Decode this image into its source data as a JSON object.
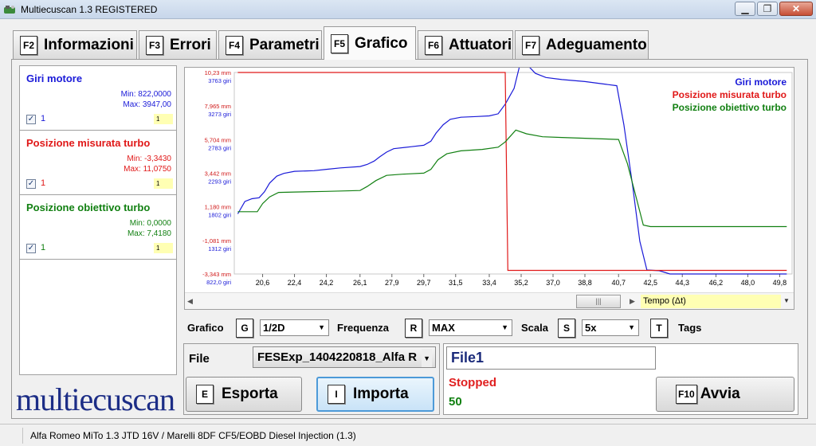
{
  "window": {
    "title": "Multiecuscan 1.3 REGISTERED",
    "minimize": "▁",
    "restore": "❐",
    "close": "✕"
  },
  "tabs": [
    {
      "key": "F2",
      "label": "Informazioni"
    },
    {
      "key": "F3",
      "label": "Errori"
    },
    {
      "key": "F4",
      "label": "Parametri"
    },
    {
      "key": "F5",
      "label": "Grafico",
      "active": true
    },
    {
      "key": "F6",
      "label": "Attuatori"
    },
    {
      "key": "F7",
      "label": "Adeguamento"
    }
  ],
  "series_panel": [
    {
      "name": "Giri motore",
      "min": "Min: 822,0000",
      "max": "Max: 3947,00",
      "checked": "✓",
      "index": "1",
      "box": "1",
      "color": "#1a1ad8"
    },
    {
      "name": "Posizione misurata turbo",
      "min": "Min: -3,3430",
      "max": "Max: 11,0750",
      "checked": "✓",
      "index": "1",
      "box": "1",
      "color": "#e01818"
    },
    {
      "name": "Posizione obiettivo turbo",
      "min": "Min: 0,0000",
      "max": "Max: 7,4180",
      "checked": "✓",
      "index": "1",
      "box": "1",
      "color": "#128012"
    }
  ],
  "chart_data": {
    "type": "line",
    "xlabel": "Tempo (Δt)",
    "x_ticks": [
      "20,6",
      "22,4",
      "24,2",
      "26,1",
      "27,9",
      "29,7",
      "31,5",
      "33,4",
      "35,2",
      "37,0",
      "38,8",
      "40,7",
      "42,5",
      "44,3",
      "46,2",
      "48,0",
      "49,8"
    ],
    "x_range": [
      19.0,
      50.5
    ],
    "y_ticks_mm": [
      "10,23 mm",
      "7,965 mm",
      "5,704 mm",
      "3,442 mm",
      "1,180 mm",
      "-1,081 mm",
      "-3,343 mm"
    ],
    "y_ticks_giri": [
      "3763 giri",
      "3273 giri",
      "2783 giri",
      "2293 giri",
      "1802 giri",
      "1312 giri",
      "822,0 giri"
    ],
    "legend": [
      {
        "name": "Giri motore",
        "color": "#1a1ad8"
      },
      {
        "name": "Posizione misurata turbo",
        "color": "#e01818"
      },
      {
        "name": "Posizione obiettivo turbo",
        "color": "#128012"
      }
    ],
    "series": [
      {
        "name": "Giri motore",
        "unit": "giri",
        "color": "#1a1ad8",
        "y_range": [
          822,
          3763
        ],
        "points": [
          [
            19.2,
            1700
          ],
          [
            19.6,
            1880
          ],
          [
            20.0,
            1920
          ],
          [
            20.4,
            1935
          ],
          [
            20.7,
            2020
          ],
          [
            21.0,
            2150
          ],
          [
            21.4,
            2250
          ],
          [
            21.8,
            2290
          ],
          [
            22.4,
            2320
          ],
          [
            23.5,
            2330
          ],
          [
            24.2,
            2350
          ],
          [
            25.0,
            2370
          ],
          [
            26.1,
            2390
          ],
          [
            26.5,
            2420
          ],
          [
            26.9,
            2470
          ],
          [
            27.2,
            2530
          ],
          [
            27.6,
            2600
          ],
          [
            28.0,
            2650
          ],
          [
            29.0,
            2680
          ],
          [
            29.7,
            2700
          ],
          [
            30.1,
            2760
          ],
          [
            30.4,
            2880
          ],
          [
            30.8,
            3000
          ],
          [
            31.2,
            3080
          ],
          [
            31.8,
            3110
          ],
          [
            32.7,
            3120
          ],
          [
            33.4,
            3130
          ],
          [
            33.9,
            3160
          ],
          [
            34.3,
            3300
          ],
          [
            34.8,
            3530
          ],
          [
            35.2,
            3950
          ],
          [
            35.6,
            3860
          ],
          [
            36.0,
            3750
          ],
          [
            36.6,
            3690
          ],
          [
            37.5,
            3660
          ],
          [
            38.8,
            3630
          ],
          [
            40.0,
            3590
          ],
          [
            40.6,
            3570
          ],
          [
            41.0,
            3000
          ],
          [
            41.5,
            2100
          ],
          [
            41.9,
            1300
          ],
          [
            42.3,
            880
          ],
          [
            43.0,
            870
          ],
          [
            43.6,
            822
          ],
          [
            50.2,
            822
          ]
        ]
      },
      {
        "name": "Posizione misurata turbo",
        "unit": "mm",
        "color": "#e01818",
        "y_range": [
          -3.343,
          10.23
        ],
        "points": [
          [
            19.2,
            10.23
          ],
          [
            34.3,
            10.23
          ],
          [
            34.45,
            -3.1
          ],
          [
            50.2,
            -3.1
          ]
        ]
      },
      {
        "name": "Posizione obiettivo turbo",
        "unit": "mm",
        "color": "#128012",
        "y_range": [
          -3.343,
          10.23
        ],
        "points": [
          [
            19.2,
            0.85
          ],
          [
            20.3,
            0.85
          ],
          [
            20.6,
            1.4
          ],
          [
            21.0,
            1.85
          ],
          [
            21.5,
            2.15
          ],
          [
            22.4,
            2.18
          ],
          [
            24.2,
            2.22
          ],
          [
            26.1,
            2.28
          ],
          [
            26.5,
            2.55
          ],
          [
            27.0,
            2.95
          ],
          [
            27.6,
            3.3
          ],
          [
            28.5,
            3.38
          ],
          [
            29.7,
            3.45
          ],
          [
            30.1,
            3.7
          ],
          [
            30.5,
            4.35
          ],
          [
            31.0,
            4.75
          ],
          [
            31.8,
            4.95
          ],
          [
            33.0,
            5.05
          ],
          [
            33.9,
            5.2
          ],
          [
            34.3,
            5.55
          ],
          [
            34.9,
            6.35
          ],
          [
            35.5,
            6.1
          ],
          [
            36.4,
            5.9
          ],
          [
            37.5,
            5.85
          ],
          [
            38.8,
            5.8
          ],
          [
            40.7,
            5.72
          ],
          [
            41.2,
            4.1
          ],
          [
            41.7,
            1.8
          ],
          [
            42.1,
            -0.05
          ],
          [
            42.5,
            -0.15
          ],
          [
            50.2,
            -0.15
          ]
        ]
      }
    ]
  },
  "scroll": {
    "left": "◀",
    "thumb": "|||",
    "right": "▶",
    "dropdown": "▼"
  },
  "controls": {
    "grafico_label": "Grafico",
    "grafico_key": "G",
    "grafico_value": "1/2D",
    "frequenza_label": "Frequenza",
    "frequenza_key": "R",
    "frequenza_value": "MAX",
    "scala_label": "Scala",
    "scala_key": "S",
    "scala_value": "5x",
    "tags_key": "T",
    "tags_label": "Tags",
    "arrow": "▼"
  },
  "file_panel": {
    "label": "File",
    "selected": "FESExp_1404220818_Alfa R",
    "esporta_key": "E",
    "esporta_label": "Esporta",
    "importa_key": "I",
    "importa_label": "Importa"
  },
  "status_panel": {
    "file_name": "File1",
    "status": "Stopped",
    "count": "50",
    "avvia_key": "F10",
    "avvia_label": "Avvia"
  },
  "logo": "multiecuscan",
  "statusbar": {
    "text": "Alfa Romeo MiTo 1.3 JTD 16V / Marelli 8DF CF5/EOBD Diesel Injection (1.3)"
  }
}
